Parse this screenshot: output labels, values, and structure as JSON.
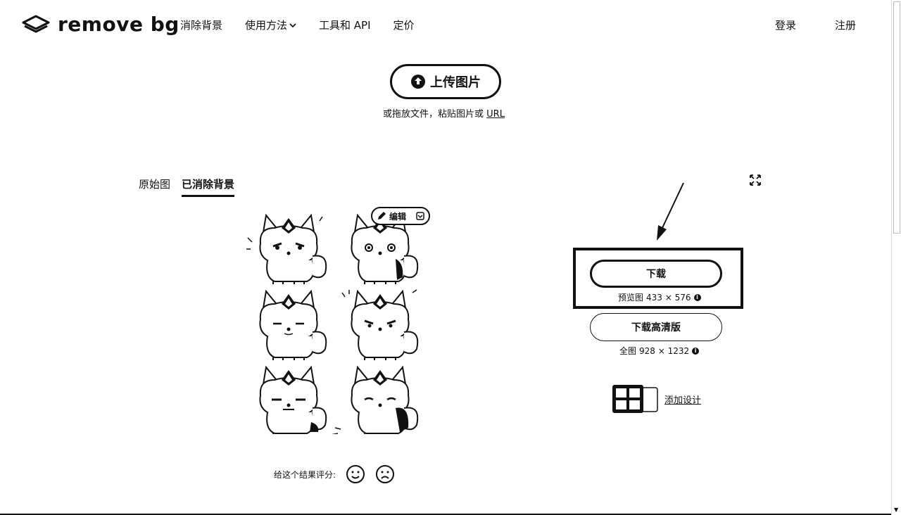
{
  "brand": {
    "name": "remove bg"
  },
  "nav": {
    "items": [
      "消除背景",
      "使用方法",
      "工具和 API",
      "定价"
    ]
  },
  "auth": {
    "login": "登录",
    "signup": "注册"
  },
  "upload": {
    "button": "上传图片",
    "hint": "或拖放文件，粘贴图片或",
    "url": "URL"
  },
  "tabs": [
    "原始图",
    "已消除背景"
  ],
  "edit": {
    "label": "编辑"
  },
  "download": {
    "button": "下载",
    "preview_label": "预览图",
    "preview_size": "433 × 576",
    "hd_button": "下载高清版",
    "full_label": "全图",
    "full_size": "928 × 1232"
  },
  "add_design": {
    "label": "添加设计"
  },
  "rating": {
    "label": "给这个结果评分:"
  },
  "colors": {
    "primary": "#111111",
    "background": "#ffffff"
  }
}
